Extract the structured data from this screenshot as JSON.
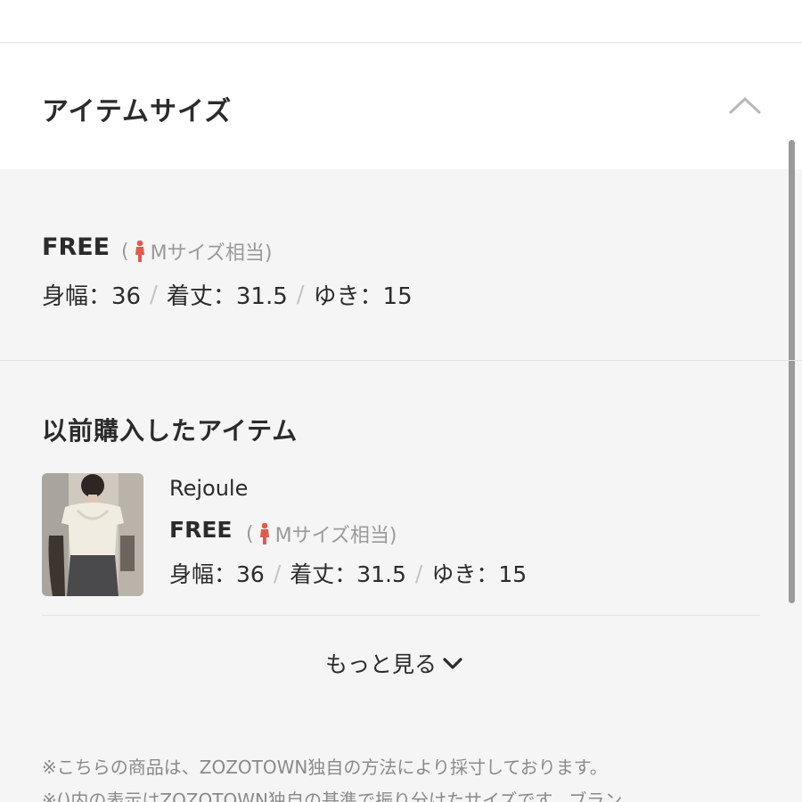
{
  "section": {
    "title": "アイテムサイズ"
  },
  "current_size": {
    "name": "FREE",
    "note_open": "(",
    "note_text": "Mサイズ相当)",
    "measurements": [
      {
        "label": "身幅：36"
      },
      {
        "label": "着丈：31.5"
      },
      {
        "label": "ゆき：15"
      }
    ],
    "separator": "/"
  },
  "previous": {
    "title": "以前購入したアイテム",
    "item": {
      "brand": "Rejoule",
      "size": "FREE",
      "note_open": "(",
      "note_text": "Mサイズ相当)",
      "measurements": [
        {
          "label": "身幅：36"
        },
        {
          "label": "着丈：31.5"
        },
        {
          "label": "ゆき：15"
        }
      ]
    },
    "more_label": "もっと見る"
  },
  "notes": [
    "※こちらの商品は、ZOZOTOWN独自の方法により採寸しております。",
    "※()内の表示はZOZOTOWN独自の基準で振り分けたサイズです。ブラン"
  ],
  "colors": {
    "accent_red": "#e05a4e",
    "text": "#2b2b2b",
    "muted": "#9a9a9a"
  },
  "icons": {
    "collapse": "chevron-up-icon",
    "expand": "chevron-down-icon",
    "size_figure": "person-icon"
  }
}
